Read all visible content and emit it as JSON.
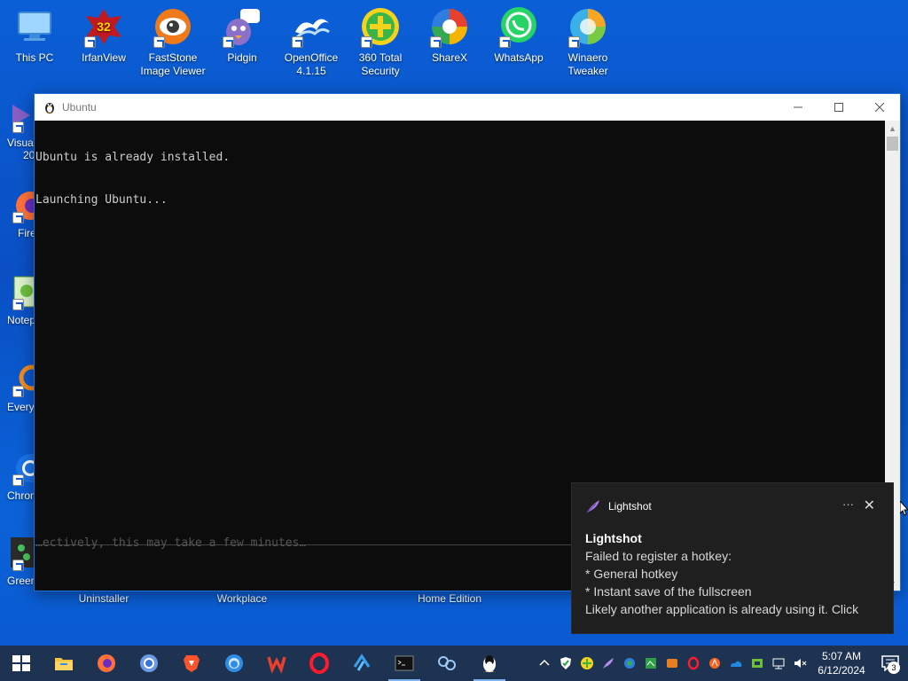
{
  "desktop": {
    "top_icons": [
      {
        "label": "This PC",
        "icon": "this-pc-icon"
      },
      {
        "label": "IrfanView",
        "icon": "irfanview-icon",
        "badge": "32"
      },
      {
        "label": "FastStone Image Viewer",
        "icon": "faststone-icon"
      },
      {
        "label": "Pidgin",
        "icon": "pidgin-icon"
      },
      {
        "label": "OpenOffice 4.1.15",
        "icon": "openoffice-icon"
      },
      {
        "label": "360 Total Security",
        "icon": "360-security-icon"
      },
      {
        "label": "ShareX",
        "icon": "sharex-icon"
      },
      {
        "label": "WhatsApp",
        "icon": "whatsapp-icon"
      },
      {
        "label": "Winaero Tweaker",
        "icon": "winaero-icon"
      }
    ],
    "left_icons": [
      {
        "label": "Visual",
        "extra": "20",
        "icon": "visual-studio-icon"
      },
      {
        "label": "Fire",
        "icon": "firefox-icon"
      },
      {
        "label": "Notep",
        "icon": "notepad-icon"
      },
      {
        "label": "Every",
        "icon": "everything-icon"
      },
      {
        "label": "Chron",
        "icon": "chrome-icon"
      },
      {
        "label": "Greer",
        "icon": "greenshot-icon"
      }
    ],
    "bottom_labels": [
      "Uninstaller",
      "Workplace",
      "Home Edition"
    ]
  },
  "ubuntu_window": {
    "title": "Ubuntu",
    "terminal_lines": [
      "Ubuntu is already installed.",
      "Launching Ubuntu..."
    ],
    "faded_line": "…ectively, this may take a few minutes…"
  },
  "toast": {
    "app": "Lightshot",
    "more": "···",
    "title": "Lightshot",
    "lines": [
      "Failed to register a hotkey:",
      "* General hotkey",
      "* Instant save of the fullscreen",
      "Likely another application is already using it. Click"
    ]
  },
  "taskbar": {
    "apps": [
      "start-icon",
      "file-explorer-icon",
      "firefox-icon",
      "chrome-icon",
      "brave-icon",
      "edge-icon",
      "wps-icon",
      "opera-icon",
      "vscode-icon",
      "terminal-icon",
      "network-tool-icon",
      "linux-tux-icon"
    ],
    "clock_time": "5:07 AM",
    "clock_date": "6/12/2024",
    "notification_count": "3"
  }
}
